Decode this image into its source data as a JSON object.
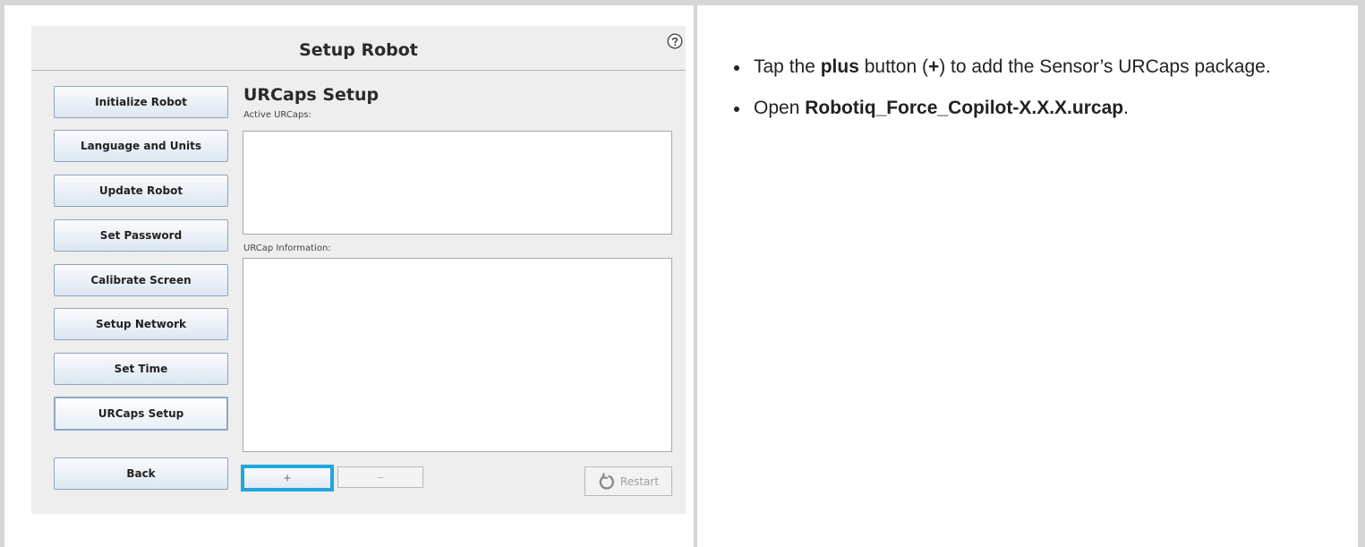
{
  "setup": {
    "title": "Setup Robot",
    "nav": [
      {
        "label": "Initialize Robot"
      },
      {
        "label": "Language and Units"
      },
      {
        "label": "Update Robot"
      },
      {
        "label": "Set Password"
      },
      {
        "label": "Calibrate Screen"
      },
      {
        "label": "Setup Network"
      },
      {
        "label": "Set Time"
      },
      {
        "label": "URCaps Setup",
        "active": true
      }
    ],
    "back_label": "Back",
    "section_title": "URCaps Setup",
    "active_urcaps_label": "Active URCaps:",
    "urcap_info_label": "URCap Information:",
    "add_symbol": "+",
    "remove_symbol": "−",
    "restart_label": "Restart"
  },
  "instructions": {
    "item1": {
      "pre": "Tap the ",
      "bold1": "plus",
      "mid1": " button (",
      "bold2": "+",
      "post": ") to add the Sensor’s URCaps package."
    },
    "item2": {
      "pre": "Open ",
      "bold": "Robotiq_Force_Copilot-X.X.X.urcap",
      "post": "."
    }
  },
  "colors": {
    "highlight": "#1ea7e0",
    "button_border": "#8fa4bd",
    "panel_bg": "#eeeeee"
  },
  "icons": {
    "help": "help-icon",
    "restart": "restart-icon",
    "add": "plus-icon",
    "remove": "minus-icon"
  }
}
